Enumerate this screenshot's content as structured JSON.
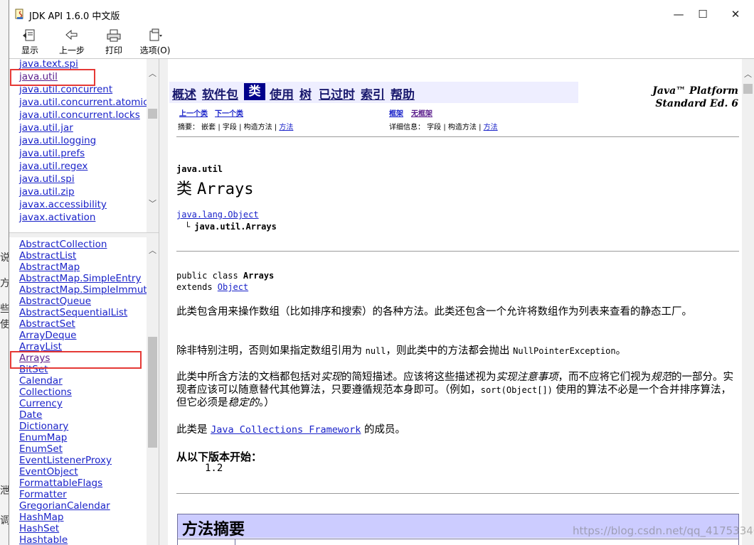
{
  "window": {
    "title": "JDK API 1.6.0 中文版",
    "minimize": "—",
    "maximize": "☐",
    "close": "✕"
  },
  "background": {
    "fragments": [
      "说",
      "方",
      "些",
      "使",
      "泄",
      "调"
    ]
  },
  "toolbar": {
    "show_label": "显示",
    "back_label": "上一步",
    "print_label": "打印",
    "options_label": "选项(O)"
  },
  "packages": [
    {
      "name": "java.text.spi",
      "visited": false
    },
    {
      "name": "java.util",
      "visited": true
    },
    {
      "name": "java.util.concurrent",
      "visited": false
    },
    {
      "name": "java.util.concurrent.atomic",
      "visited": false
    },
    {
      "name": "java.util.concurrent.locks",
      "visited": false
    },
    {
      "name": "java.util.jar",
      "visited": false
    },
    {
      "name": "java.util.logging",
      "visited": false
    },
    {
      "name": "java.util.prefs",
      "visited": false
    },
    {
      "name": "java.util.regex",
      "visited": false
    },
    {
      "name": "java.util.spi",
      "visited": false
    },
    {
      "name": "java.util.zip",
      "visited": false
    },
    {
      "name": "javax.accessibility",
      "visited": false
    },
    {
      "name": "javax.activation",
      "visited": false
    }
  ],
  "classes": [
    {
      "name": "AbstractCollection",
      "visited": false
    },
    {
      "name": "AbstractList",
      "visited": false
    },
    {
      "name": "AbstractMap",
      "visited": false
    },
    {
      "name": "AbstractMap.SimpleEntry",
      "visited": false
    },
    {
      "name": "AbstractMap.SimpleImmutab",
      "visited": false
    },
    {
      "name": "AbstractQueue",
      "visited": false
    },
    {
      "name": "AbstractSequentialList",
      "visited": false
    },
    {
      "name": "AbstractSet",
      "visited": false
    },
    {
      "name": "ArrayDeque",
      "visited": false
    },
    {
      "name": "ArrayList",
      "visited": false
    },
    {
      "name": "Arrays",
      "visited": true
    },
    {
      "name": "BitSet",
      "visited": false
    },
    {
      "name": "Calendar",
      "visited": false
    },
    {
      "name": "Collections",
      "visited": false
    },
    {
      "name": "Currency",
      "visited": false
    },
    {
      "name": "Date",
      "visited": false
    },
    {
      "name": "Dictionary",
      "visited": false
    },
    {
      "name": "EnumMap",
      "visited": false
    },
    {
      "name": "EnumSet",
      "visited": false
    },
    {
      "name": "EventListenerProxy",
      "visited": false
    },
    {
      "name": "EventObject",
      "visited": false
    },
    {
      "name": "FormattableFlags",
      "visited": false
    },
    {
      "name": "Formatter",
      "visited": false
    },
    {
      "name": "GregorianCalendar",
      "visited": false
    },
    {
      "name": "HashMap",
      "visited": false
    },
    {
      "name": "HashSet",
      "visited": false
    },
    {
      "name": "Hashtable",
      "visited": false
    }
  ],
  "nav": {
    "overview": "概述",
    "package": "软件包",
    "class": "类",
    "use": "使用",
    "tree": "树",
    "deprecated": "已过时",
    "index": "索引",
    "help": "帮助",
    "platform_line1": "Java™ Platform",
    "platform_line2": "Standard Ed. 6"
  },
  "subnav": {
    "prev_class": "上一个类",
    "next_class": "下一个类",
    "frames": "框架",
    "no_frames": "无框架",
    "summary_prefix": "摘要： 嵌套 | 字段 | 构造方法 | ",
    "summary_method": "方法",
    "detail_prefix": "详细信息： 字段 | 构造方法 | ",
    "detail_method": "方法"
  },
  "doc": {
    "package": "java.util",
    "class_kind": "类",
    "class_name": "Arrays",
    "super_class": "java.lang.Object",
    "tree_branch": "└",
    "this_class": "java.util.Arrays",
    "decl_prefix": "public class ",
    "decl_name": "Arrays",
    "extends_prefix": "extends ",
    "extends_link": "Object",
    "para1": "此类包含用来操作数组（比如排序和搜索）的各种方法。此类还包含一个允许将数组作为列表来查看的静态工厂。",
    "para2_a": "除非特别注明，否则如果指定数组引用为 ",
    "para2_null": "null",
    "para2_b": "，则此类中的方法都会抛出 ",
    "para2_npe": "NullPointerException",
    "para2_c": "。",
    "para3_a": "此类中所含方法的文档都包括对",
    "para3_i1": "实现",
    "para3_b": "的简短描述。应该将这些描述视为",
    "para3_i2": "实现注意事项",
    "para3_c": "，而不应将它们视为",
    "para3_i3": "规范",
    "para3_d": "的一部分。实现者应该可以随意替代其他算法，只要遵循规范本身即可。（例如，",
    "para3_code": "sort(Object[])",
    "para3_e": " 使用的算法不必是一个合并排序算法，但它必须是",
    "para3_i4": "稳定的",
    "para3_f": "。）",
    "para4_a": "此类是 ",
    "para4_link": "Java Collections Framework",
    "para4_b": " 的成员。",
    "since_label": "从以下版本开始：",
    "since_value": "1.2",
    "method_summary": "方法摘要"
  },
  "watermark": "https://blog.csdn.net/qq_41753340",
  "colors": {
    "link": "#1a23c9",
    "visited": "#5a1d8c",
    "navbar_bg": "#eeeeff",
    "table_header_bg": "#ccccff",
    "highlight_box": "#e53935"
  }
}
